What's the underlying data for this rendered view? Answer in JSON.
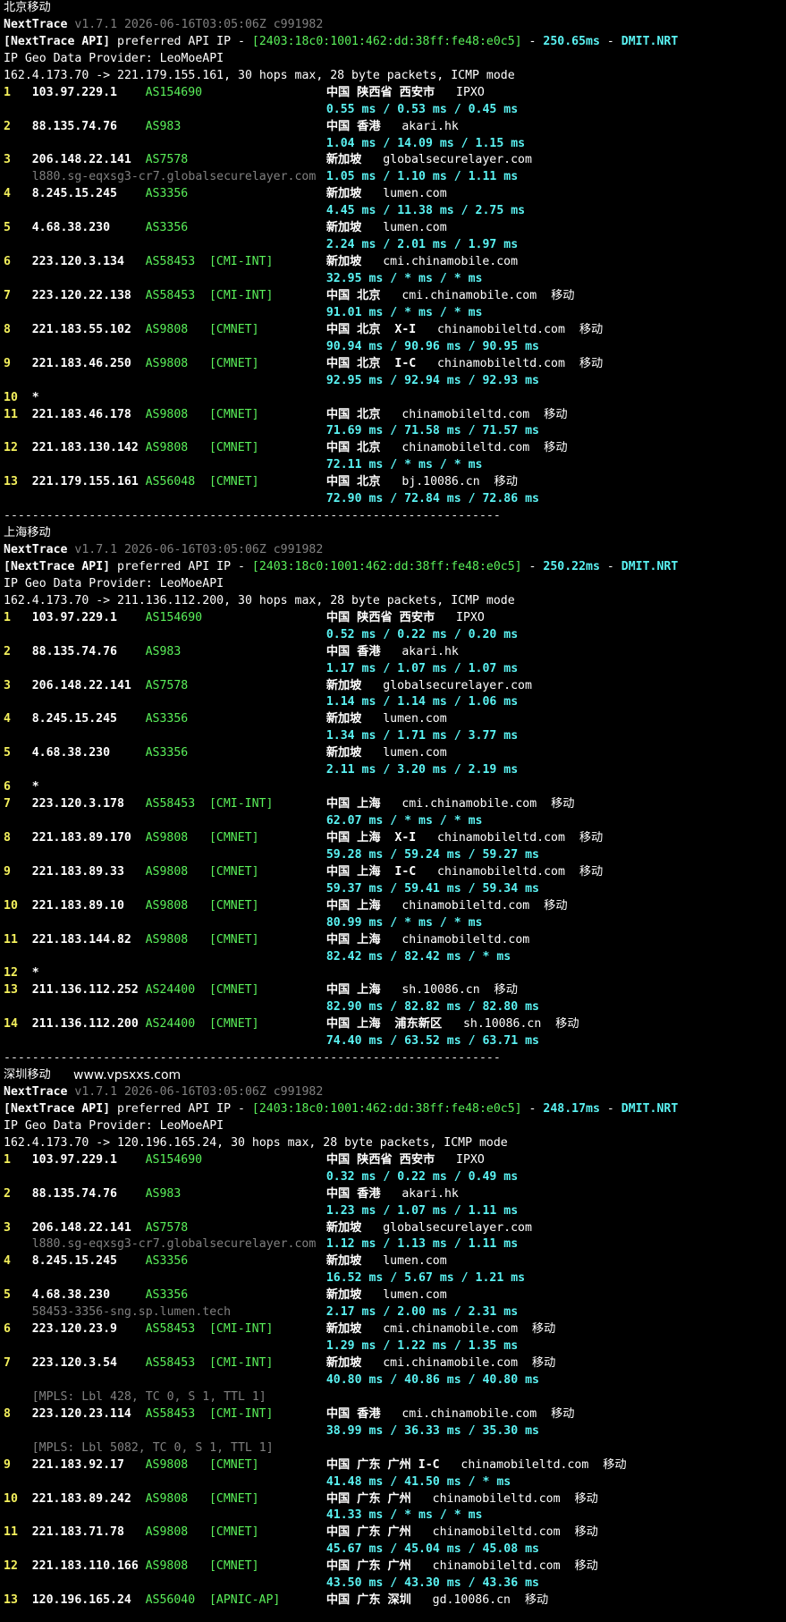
{
  "terminal": {
    "site_label": "www.vpsxxs.com",
    "separator": "----------------------------------------------------------------------",
    "sections": [
      {
        "title": "北京移动",
        "app": "NextTrace",
        "version": "v1.7.1 2026-06-16T03:05:06Z c991982",
        "api_prefix": "[NextTrace API]",
        "api_text": " preferred API IP - ",
        "api_ip": "[2403:18c0:1001:462:dd:38ff:fe48:e0c5]",
        "api_dash": " - ",
        "api_latency": "250.65ms",
        "api_dash2": " - ",
        "api_node": "DMIT.NRT",
        "geo_provider": "IP Geo Data Provider: LeoMoeAPI",
        "trace_header": "162.4.173.70 -> 221.179.155.161, 30 hops max, 28 byte packets, ICMP mode",
        "hops": [
          {
            "n": "1",
            "ip": "103.97.229.1",
            "as": "AS154690",
            "tag": "",
            "geo": "中国 陕西省 西安市",
            "dom": "IPXO",
            "isp": "",
            "rtt": "0.55 ms / 0.53 ms / 0.45 ms"
          },
          {
            "n": "2",
            "ip": "88.135.74.76",
            "as": "AS983",
            "tag": "",
            "geo": "中国 香港",
            "dom": "akari.hk",
            "isp": "",
            "rtt": "1.04 ms / 14.09 ms / 1.15 ms"
          },
          {
            "n": "3",
            "ip": "206.148.22.141",
            "as": "AS7578",
            "tag": "",
            "geo": "新加坡",
            "dom": "globalsecurelayer.com",
            "isp": "",
            "rtt": "1.05 ms / 1.10 ms / 1.11 ms",
            "rdns": "l880.sg-eqxsg3-cr7.globalsecurelayer.com"
          },
          {
            "n": "4",
            "ip": "8.245.15.245",
            "as": "AS3356",
            "tag": "",
            "geo": "新加坡",
            "dom": "lumen.com",
            "isp": "",
            "rtt": "4.45 ms / 11.38 ms / 2.75 ms"
          },
          {
            "n": "5",
            "ip": "4.68.38.230",
            "as": "AS3356",
            "tag": "",
            "geo": "新加坡",
            "dom": "lumen.com",
            "isp": "",
            "rtt": "2.24 ms / 2.01 ms / 1.97 ms"
          },
          {
            "n": "6",
            "ip": "223.120.3.134",
            "as": "AS58453",
            "tag": "[CMI-INT]",
            "geo": "新加坡",
            "dom": "cmi.chinamobile.com",
            "isp": "",
            "rtt": "32.95 ms / * ms / * ms"
          },
          {
            "n": "7",
            "ip": "223.120.22.138",
            "as": "AS58453",
            "tag": "[CMI-INT]",
            "geo": "中国 北京",
            "dom": "cmi.chinamobile.com",
            "isp": "移动",
            "rtt": "91.01 ms / * ms / * ms"
          },
          {
            "n": "8",
            "ip": "221.183.55.102",
            "as": "AS9808",
            "tag": "[CMNET]",
            "geo": "中国 北京  X-I",
            "dom": "chinamobileltd.com",
            "isp": "移动",
            "rtt": "90.94 ms / 90.96 ms / 90.95 ms"
          },
          {
            "n": "9",
            "ip": "221.183.46.250",
            "as": "AS9808",
            "tag": "[CMNET]",
            "geo": "中国 北京  I-C",
            "dom": "chinamobileltd.com",
            "isp": "移动",
            "rtt": "92.95 ms / 92.94 ms / 92.93 ms"
          },
          {
            "n": "10",
            "ip": "*",
            "as": "",
            "tag": "",
            "geo": "",
            "dom": "",
            "isp": "",
            "rtt": ""
          },
          {
            "n": "11",
            "ip": "221.183.46.178",
            "as": "AS9808",
            "tag": "[CMNET]",
            "geo": "中国 北京",
            "dom": "chinamobileltd.com",
            "isp": "移动",
            "rtt": "71.69 ms / 71.58 ms / 71.57 ms"
          },
          {
            "n": "12",
            "ip": "221.183.130.142",
            "as": "AS9808",
            "tag": "[CMNET]",
            "geo": "中国 北京",
            "dom": "chinamobileltd.com",
            "isp": "移动",
            "rtt": "72.11 ms / * ms / * ms"
          },
          {
            "n": "13",
            "ip": "221.179.155.161",
            "as": "AS56048",
            "tag": "[CMNET]",
            "geo": "中国 北京",
            "dom": "bj.10086.cn",
            "isp": "移动",
            "rtt": "72.90 ms / 72.84 ms / 72.86 ms"
          }
        ]
      },
      {
        "title": "上海移动",
        "app": "NextTrace",
        "version": "v1.7.1 2026-06-16T03:05:06Z c991982",
        "api_prefix": "[NextTrace API]",
        "api_text": " preferred API IP - ",
        "api_ip": "[2403:18c0:1001:462:dd:38ff:fe48:e0c5]",
        "api_dash": " - ",
        "api_latency": "250.22ms",
        "api_dash2": " - ",
        "api_node": "DMIT.NRT",
        "geo_provider": "IP Geo Data Provider: LeoMoeAPI",
        "trace_header": "162.4.173.70 -> 211.136.112.200, 30 hops max, 28 byte packets, ICMP mode",
        "hops": [
          {
            "n": "1",
            "ip": "103.97.229.1",
            "as": "AS154690",
            "tag": "",
            "geo": "中国 陕西省 西安市",
            "dom": "IPXO",
            "isp": "",
            "rtt": "0.52 ms / 0.22 ms / 0.20 ms"
          },
          {
            "n": "2",
            "ip": "88.135.74.76",
            "as": "AS983",
            "tag": "",
            "geo": "中国 香港",
            "dom": "akari.hk",
            "isp": "",
            "rtt": "1.17 ms / 1.07 ms / 1.07 ms"
          },
          {
            "n": "3",
            "ip": "206.148.22.141",
            "as": "AS7578",
            "tag": "",
            "geo": "新加坡",
            "dom": "globalsecurelayer.com",
            "isp": "",
            "rtt": "1.14 ms / 1.14 ms / 1.06 ms"
          },
          {
            "n": "4",
            "ip": "8.245.15.245",
            "as": "AS3356",
            "tag": "",
            "geo": "新加坡",
            "dom": "lumen.com",
            "isp": "",
            "rtt": "1.34 ms / 1.71 ms / 3.77 ms"
          },
          {
            "n": "5",
            "ip": "4.68.38.230",
            "as": "AS3356",
            "tag": "",
            "geo": "新加坡",
            "dom": "lumen.com",
            "isp": "",
            "rtt": "2.11 ms / 3.20 ms / 2.19 ms"
          },
          {
            "n": "6",
            "ip": "*",
            "as": "",
            "tag": "",
            "geo": "",
            "dom": "",
            "isp": "",
            "rtt": ""
          },
          {
            "n": "7",
            "ip": "223.120.3.178",
            "as": "AS58453",
            "tag": "[CMI-INT]",
            "geo": "中国 上海",
            "dom": "cmi.chinamobile.com",
            "isp": "移动",
            "rtt": "62.07 ms / * ms / * ms"
          },
          {
            "n": "8",
            "ip": "221.183.89.170",
            "as": "AS9808",
            "tag": "[CMNET]",
            "geo": "中国 上海  X-I",
            "dom": "chinamobileltd.com",
            "isp": "移动",
            "rtt": "59.28 ms / 59.24 ms / 59.27 ms"
          },
          {
            "n": "9",
            "ip": "221.183.89.33",
            "as": "AS9808",
            "tag": "[CMNET]",
            "geo": "中国 上海  I-C",
            "dom": "chinamobileltd.com",
            "isp": "移动",
            "rtt": "59.37 ms / 59.41 ms / 59.34 ms"
          },
          {
            "n": "10",
            "ip": "221.183.89.10",
            "as": "AS9808",
            "tag": "[CMNET]",
            "geo": "中国 上海",
            "dom": "chinamobileltd.com",
            "isp": "移动",
            "rtt": "80.99 ms / * ms / * ms"
          },
          {
            "n": "11",
            "ip": "221.183.144.82",
            "as": "AS9808",
            "tag": "[CMNET]",
            "geo": "中国 上海",
            "dom": "chinamobileltd.com",
            "isp": "",
            "rtt": "82.42 ms / 82.42 ms / * ms"
          },
          {
            "n": "12",
            "ip": "*",
            "as": "",
            "tag": "",
            "geo": "",
            "dom": "",
            "isp": "",
            "rtt": ""
          },
          {
            "n": "13",
            "ip": "211.136.112.252",
            "as": "AS24400",
            "tag": "[CMNET]",
            "geo": "中国 上海",
            "dom": "sh.10086.cn",
            "isp": "移动",
            "rtt": "82.90 ms / 82.82 ms / 82.80 ms"
          },
          {
            "n": "14",
            "ip": "211.136.112.200",
            "as": "AS24400",
            "tag": "[CMNET]",
            "geo": "中国 上海  浦东新区",
            "dom": "sh.10086.cn",
            "isp": "移动",
            "rtt": "74.40 ms / 63.52 ms / 63.71 ms"
          }
        ]
      },
      {
        "title": "深圳移动",
        "app": "NextTrace",
        "version": "v1.7.1 2026-06-16T03:05:06Z c991982",
        "api_prefix": "[NextTrace API]",
        "api_text": " preferred API IP - ",
        "api_ip": "[2403:18c0:1001:462:dd:38ff:fe48:e0c5]",
        "api_dash": " - ",
        "api_latency": "248.17ms",
        "api_dash2": " - ",
        "api_node": "DMIT.NRT",
        "geo_provider": "IP Geo Data Provider: LeoMoeAPI",
        "trace_header": "162.4.173.70 -> 120.196.165.24, 30 hops max, 28 byte packets, ICMP mode",
        "hops": [
          {
            "n": "1",
            "ip": "103.97.229.1",
            "as": "AS154690",
            "tag": "",
            "geo": "中国 陕西省 西安市",
            "dom": "IPXO",
            "isp": "",
            "rtt": "0.32 ms / 0.22 ms / 0.49 ms"
          },
          {
            "n": "2",
            "ip": "88.135.74.76",
            "as": "AS983",
            "tag": "",
            "geo": "中国 香港",
            "dom": "akari.hk",
            "isp": "",
            "rtt": "1.23 ms / 1.07 ms / 1.11 ms"
          },
          {
            "n": "3",
            "ip": "206.148.22.141",
            "as": "AS7578",
            "tag": "",
            "geo": "新加坡",
            "dom": "globalsecurelayer.com",
            "isp": "",
            "rtt": "1.12 ms / 1.13 ms / 1.11 ms",
            "rdns": "l880.sg-eqxsg3-cr7.globalsecurelayer.com"
          },
          {
            "n": "4",
            "ip": "8.245.15.245",
            "as": "AS3356",
            "tag": "",
            "geo": "新加坡",
            "dom": "lumen.com",
            "isp": "",
            "rtt": "16.52 ms / 5.67 ms / 1.21 ms"
          },
          {
            "n": "5",
            "ip": "4.68.38.230",
            "as": "AS3356",
            "tag": "",
            "geo": "新加坡",
            "dom": "lumen.com",
            "isp": "",
            "rtt": "2.17 ms / 2.00 ms / 2.31 ms",
            "rdns": "58453-3356-sng.sp.lumen.tech"
          },
          {
            "n": "6",
            "ip": "223.120.23.9",
            "as": "AS58453",
            "tag": "[CMI-INT]",
            "geo": "新加坡",
            "dom": "cmi.chinamobile.com",
            "isp": "移动",
            "rtt": "1.29 ms / 1.22 ms / 1.35 ms"
          },
          {
            "n": "7",
            "ip": "223.120.3.54",
            "as": "AS58453",
            "tag": "[CMI-INT]",
            "geo": "新加坡",
            "dom": "cmi.chinamobile.com",
            "isp": "移动",
            "rtt": "40.80 ms / 40.86 ms / 40.80 ms",
            "mpls": "[MPLS: Lbl 428, TC 0, S 1, TTL 1]"
          },
          {
            "n": "8",
            "ip": "223.120.23.114",
            "as": "AS58453",
            "tag": "[CMI-INT]",
            "geo": "中国 香港",
            "dom": "cmi.chinamobile.com",
            "isp": "移动",
            "rtt": "38.99 ms / 36.33 ms / 35.30 ms",
            "mpls": "[MPLS: Lbl 5082, TC 0, S 1, TTL 1]"
          },
          {
            "n": "9",
            "ip": "221.183.92.17",
            "as": "AS9808",
            "tag": "[CMNET]",
            "geo": "中国 广东 广州 I-C",
            "dom": "chinamobileltd.com",
            "isp": "移动",
            "rtt": "41.48 ms / 41.50 ms / * ms"
          },
          {
            "n": "10",
            "ip": "221.183.89.242",
            "as": "AS9808",
            "tag": "[CMNET]",
            "geo": "中国 广东 广州",
            "dom": "chinamobileltd.com",
            "isp": "移动",
            "rtt": "41.33 ms / * ms / * ms"
          },
          {
            "n": "11",
            "ip": "221.183.71.78",
            "as": "AS9808",
            "tag": "[CMNET]",
            "geo": "中国 广东 广州",
            "dom": "chinamobileltd.com",
            "isp": "移动",
            "rtt": "45.67 ms / 45.04 ms / 45.08 ms"
          },
          {
            "n": "12",
            "ip": "221.183.110.166",
            "as": "AS9808",
            "tag": "[CMNET]",
            "geo": "中国 广东 广州",
            "dom": "chinamobileltd.com",
            "isp": "移动",
            "rtt": "43.50 ms / 43.30 ms / 43.36 ms"
          },
          {
            "n": "13",
            "ip": "120.196.165.24",
            "as": "AS56040",
            "tag": "[APNIC-AP]",
            "geo": "中国 广东 深圳",
            "dom": "gd.10086.cn",
            "isp": "移动",
            "rtt": ""
          }
        ]
      }
    ]
  }
}
